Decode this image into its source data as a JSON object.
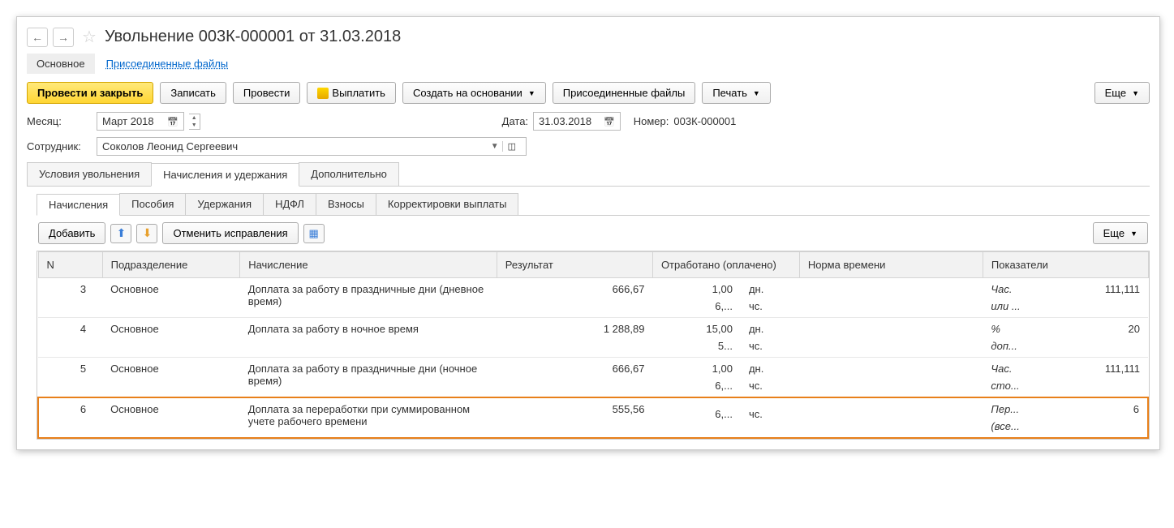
{
  "title": "Увольнение 003К-000001 от 31.03.2018",
  "topTabs": {
    "main": "Основное",
    "files": "Присоединенные файлы"
  },
  "toolbar": {
    "postClose": "Провести и закрыть",
    "save": "Записать",
    "post": "Провести",
    "pay": "Выплатить",
    "createBased": "Создать на основании",
    "attached": "Присоединенные файлы",
    "print": "Печать",
    "more": "Еще"
  },
  "fields": {
    "monthLabel": "Месяц:",
    "monthValue": "Март 2018",
    "dateLabel": "Дата:",
    "dateValue": "31.03.2018",
    "numberLabel": "Номер:",
    "numberValue": "003К-000001",
    "employeeLabel": "Сотрудник:",
    "employeeValue": "Соколов Леонид Сергеевич"
  },
  "formTabs": {
    "conditions": "Условия увольнения",
    "accruals": "Начисления и удержания",
    "additional": "Дополнительно"
  },
  "subTabs": {
    "accruals": "Начисления",
    "benefits": "Пособия",
    "deductions": "Удержания",
    "ndfl": "НДФЛ",
    "contrib": "Взносы",
    "corrections": "Корректировки выплаты"
  },
  "subToolbar": {
    "add": "Добавить",
    "cancel": "Отменить исправления",
    "more": "Еще"
  },
  "gridHeaders": {
    "n": "N",
    "dept": "Подразделение",
    "accrual": "Начисление",
    "result": "Результат",
    "worked": "Отработано (оплачено)",
    "norm": "Норма времени",
    "indicators": "Показатели"
  },
  "rows": [
    {
      "n": "3",
      "dept": "Основное",
      "accrual": "Доплата за работу в праздничные дни (дневное время)",
      "result": "666,67",
      "worked1": "1,00",
      "unit1": "дн.",
      "worked2": "6,...",
      "unit2": "чс.",
      "ind1": "Час.",
      "ind2": "или ...",
      "val": "111,111"
    },
    {
      "n": "4",
      "dept": "Основное",
      "accrual": "Доплата за работу в ночное время",
      "result": "1 288,89",
      "worked1": "15,00",
      "unit1": "дн.",
      "worked2": "5...",
      "unit2": "чс.",
      "ind1": "%",
      "ind2": "доп...",
      "val": "20"
    },
    {
      "n": "5",
      "dept": "Основное",
      "accrual": "Доплата за работу в праздничные дни (ночное время)",
      "result": "666,67",
      "worked1": "1,00",
      "unit1": "дн.",
      "worked2": "6,...",
      "unit2": "чс.",
      "ind1": "Час.",
      "ind2": "сто...",
      "val": "111,111"
    },
    {
      "n": "6",
      "dept": "Основное",
      "accrual": "Доплата за переработки при суммированном учете рабочего времени",
      "result": "555,56",
      "worked1": "",
      "unit1": "",
      "worked2": "6,...",
      "unit2": "чс.",
      "ind1": "Пер...",
      "ind2": "(все...",
      "val": "6"
    }
  ]
}
